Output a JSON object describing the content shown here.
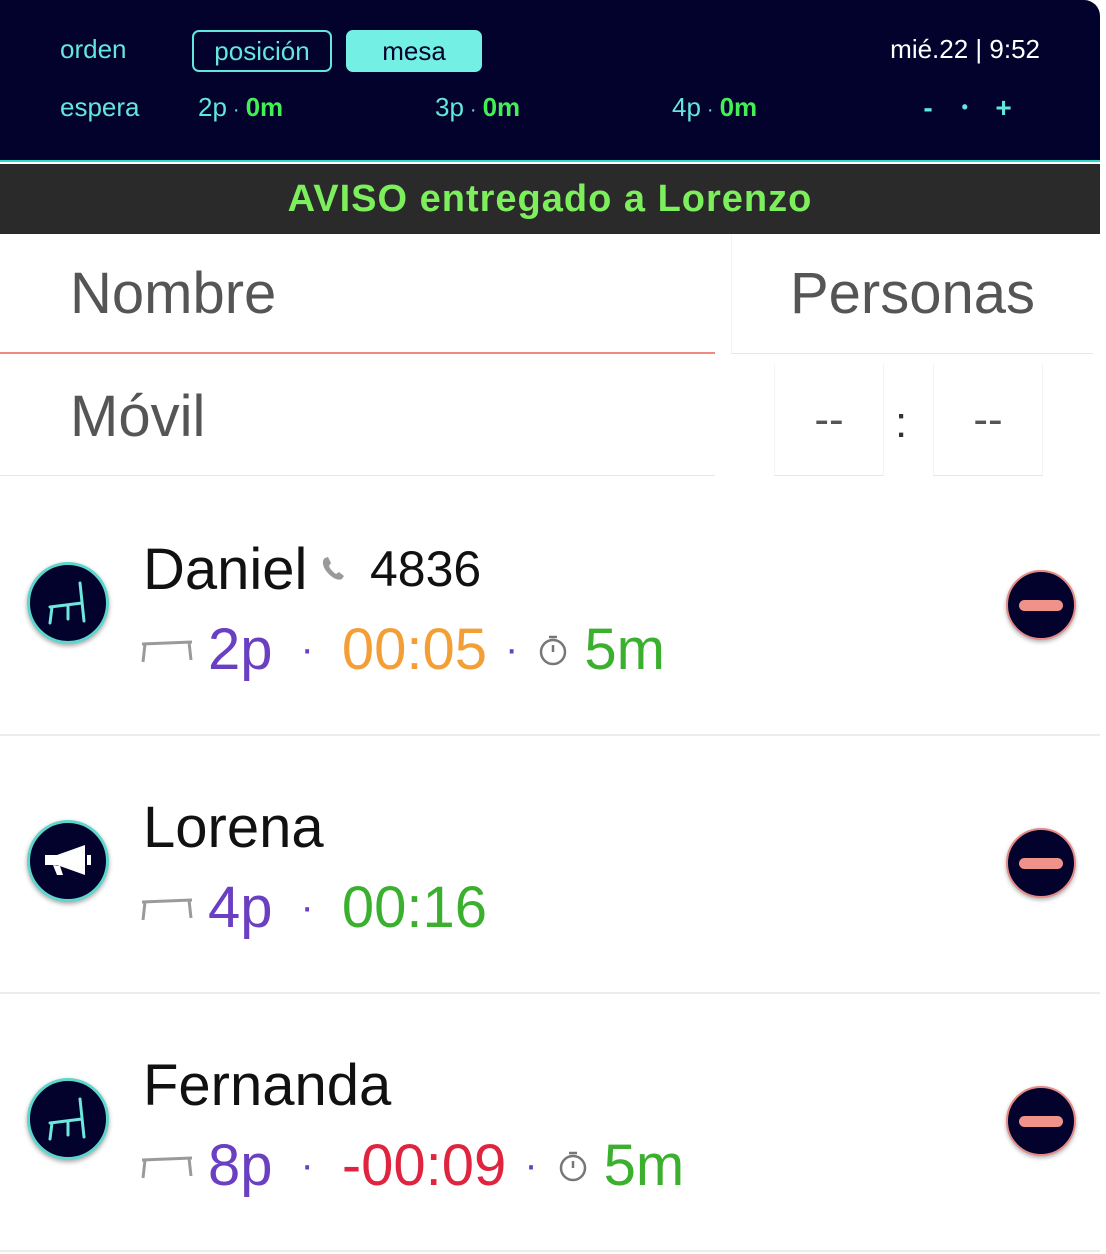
{
  "header": {
    "order_label": "orden",
    "sort_options": [
      {
        "label": "posición",
        "active": false
      },
      {
        "label": "mesa",
        "active": true
      }
    ],
    "clock": "mié.22 | 9:52",
    "wait_label": "espera",
    "wait_stats": [
      {
        "party": "2p",
        "sep": "·",
        "minutes": "0m"
      },
      {
        "party": "3p",
        "sep": "·",
        "minutes": "0m"
      },
      {
        "party": "4p",
        "sep": "·",
        "minutes": "0m"
      }
    ],
    "zoom": {
      "minus": "-",
      "dot": "•",
      "plus": "+"
    }
  },
  "notice": "AVISO entregado a Lorenzo",
  "form": {
    "name_placeholder": "Nombre",
    "people_placeholder": "Personas",
    "phone_placeholder": "Móvil",
    "hour_placeholder": "--",
    "minute_placeholder": "--",
    "time_separator": ":"
  },
  "guests": [
    {
      "name": "Daniel",
      "status_icon": "chair-icon",
      "phone": "4836",
      "party": "2p",
      "dot": "·",
      "time": "00:05",
      "time_color": "orange",
      "wait": "5m"
    },
    {
      "name": "Lorena",
      "status_icon": "megaphone-icon",
      "party": "4p",
      "dot": "·",
      "time": "00:16",
      "time_color": "green"
    },
    {
      "name": "Fernanda",
      "status_icon": "chair-icon",
      "party": "8p",
      "dot": "·",
      "time": "-00:09",
      "time_color": "red",
      "wait": "5m"
    }
  ],
  "colors": {
    "header_bg": "#02022c",
    "accent_cyan": "#63e6dc",
    "notice_green": "#7dee5c",
    "party_purple": "#6a3fc2",
    "late_red": "#e0243f",
    "soon_orange": "#f49f36",
    "ok_green": "#3bb02e"
  }
}
